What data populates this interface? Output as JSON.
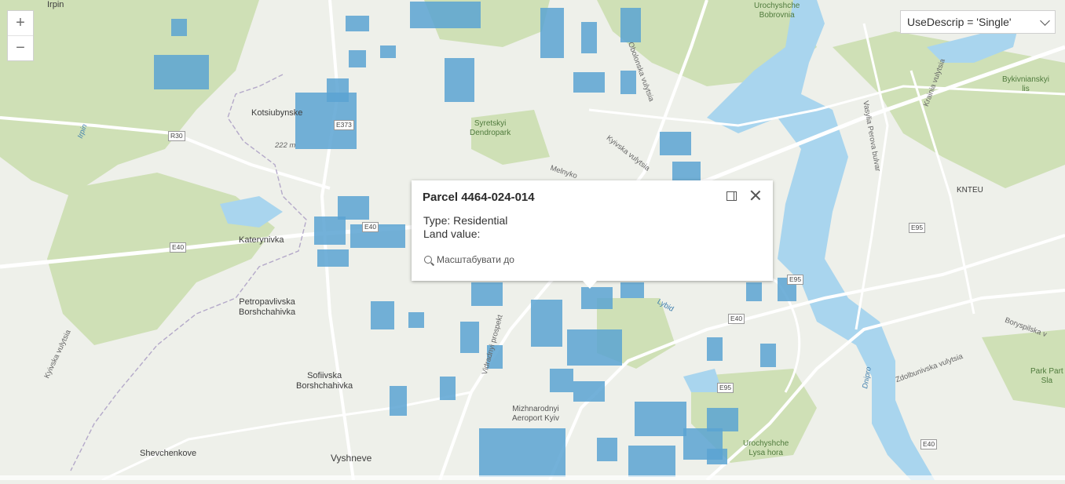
{
  "zoom": {
    "in_label": "+",
    "out_label": "−"
  },
  "filter": {
    "value": "UseDescrip = 'Single'"
  },
  "popup": {
    "title": "Parcel 4464-024-014",
    "type_line": "Type: Residential",
    "land_value_line": "Land value:",
    "zoom_to_label": "Масштабувати до"
  },
  "labels": {
    "irpin_top": "Irpin",
    "kotsiubynske": "Kotsiubynske",
    "elevation": "222 m",
    "katerynivka": "Katerynivka",
    "petropavlivska": "Petropavlivska\nBorshchahivka",
    "sofiivska": "Sofiivska\nBorshchahivka",
    "shevchenkove": "Shevchenkove",
    "vyshneve": "Vyshneve",
    "syretskyi": "Syretskyi\nDendropark",
    "aeroport": "Mizhnarodnyi\nAeroport Kyiv",
    "urochyshche_bobrovnia": "Urochyshche\nBobrovnia",
    "urochyshche_lysa": "Urochyshche\nLysa hora",
    "bykivnianskyi": "Bykivnianskyi\nlis",
    "park_partial": "Park Part\nSla",
    "kntu": "KNTEU",
    "irpin_river": "Irpin",
    "dnipro": "Dnipro",
    "lybid": "Lybid",
    "melnyk": "Melnyko",
    "kyivska": "Kyivska vulytsia",
    "vasylia": "Vasylia Perova bulvar",
    "krainia": "Krainia vulytsia",
    "boryspilska": "Boryspilska v",
    "zdolbunivska": "Zdolbunivska vulytsia",
    "vidradnyi": "Vidradnyi prospekt",
    "kyivska_left": "Kyivska vulytsia",
    "obolonska": "Obolonska vulytsia"
  },
  "shields": {
    "r30": "R30",
    "e373": "E373",
    "e40_a": "E40",
    "e40_b": "E40",
    "e40_c": "E40",
    "e40_d": "E40",
    "e95_a": "E95",
    "e95_b": "E95",
    "e95_c": "E95"
  },
  "colors": {
    "parcel": "#5aa3d2",
    "water": "#a9d5ee",
    "park": "#cfe0b6",
    "road": "#ffffff",
    "land": "#eef0ea"
  }
}
